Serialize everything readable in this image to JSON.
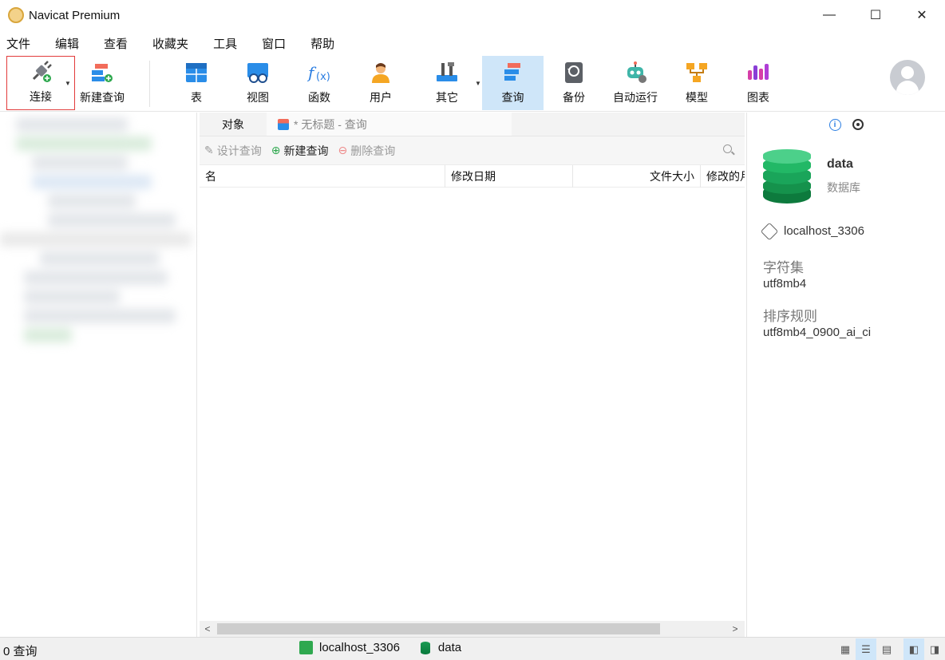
{
  "window": {
    "title": "Navicat Premium",
    "controls": {
      "minimize": "—",
      "maximize": "☐",
      "close": "✕"
    }
  },
  "menu": [
    "文件",
    "编辑",
    "查看",
    "收藏夹",
    "工具",
    "窗口",
    "帮助"
  ],
  "toolbar": {
    "connect": "连接",
    "new_query": "新建查询",
    "table": "表",
    "view": "视图",
    "function": "函数",
    "user": "用户",
    "other": "其它",
    "query": "查询",
    "backup": "备份",
    "automation": "自动运行",
    "model": "模型",
    "chart": "图表"
  },
  "tabs": {
    "objects": "对象",
    "query_tab": "* 无标题 - 查询"
  },
  "object_actions": {
    "design": "设计查询",
    "new": "新建查询",
    "delete": "删除查询"
  },
  "columns": [
    "名",
    "修改日期",
    "文件大小",
    "修改的月"
  ],
  "info_panel": {
    "db_name": "data",
    "db_type": "数据库",
    "connection": "localhost_3306",
    "charset_label": "字符集",
    "charset_value": "utf8mb4",
    "collation_label": "排序规则",
    "collation_value": "utf8mb4_0900_ai_ci"
  },
  "status": {
    "count": "0 查询",
    "connection": "localhost_3306",
    "database": "data"
  },
  "colors": {
    "accent_active": "#cfe6f9",
    "db_green": "#1a9a52",
    "highlight_red": "#e23b3b"
  }
}
